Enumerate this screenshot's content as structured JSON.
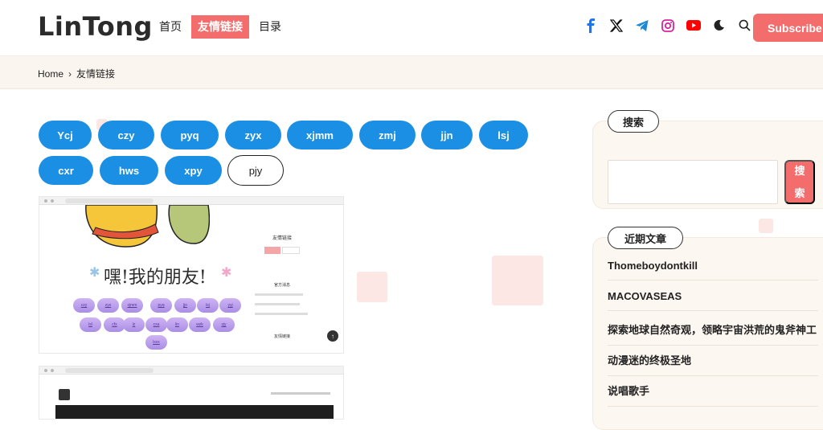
{
  "header": {
    "logo": "LinTong",
    "nav": [
      {
        "label": "首页"
      },
      {
        "label": "友情链接"
      },
      {
        "label": "目录"
      }
    ],
    "subscribe_label": "Subscribe",
    "icons": [
      "facebook-icon",
      "x-icon",
      "telegram-icon",
      "instagram-icon",
      "youtube-icon",
      "dark-mode-icon",
      "search-icon"
    ]
  },
  "breadcrumb": {
    "home": "Home",
    "current": "友情链接"
  },
  "tags": [
    "Ycj",
    "czy",
    "pyq",
    "zyx",
    "xjmm",
    "zmj",
    "jjn",
    "lsj",
    "cxr",
    "hws",
    "xpy",
    "pjy"
  ],
  "screenshots": {
    "first": {
      "title_text": "嘿!我的朋友!",
      "sidebar_heading": "友情链接",
      "sidebar_heading2": "官方消息",
      "sidebar_heading3": "友情链接",
      "bubbles": [
        "czy",
        "zyx",
        "xjmm",
        "pyq",
        "jjn",
        "lsj",
        "yyj",
        "lsl",
        "cfx",
        "lz",
        "cxa",
        "lin",
        "wzk",
        "zjy",
        "lxxx"
      ]
    }
  },
  "sidebar": {
    "search": {
      "label": "搜索",
      "button_char1": "搜",
      "button_char2": "索",
      "placeholder": ""
    },
    "recent": {
      "label": "近期文章",
      "posts": [
        "Thomeboydontkill",
        "MACOVASEAS",
        "探索地球自然奇观，领略宇宙洪荒的鬼斧神工",
        "动漫迷的终极圣地",
        "说唱歌手"
      ]
    }
  },
  "colors": {
    "accent": "#f46d6d",
    "tag_blue": "#1a8fe3",
    "crumb_bg": "#fbf5ef"
  }
}
